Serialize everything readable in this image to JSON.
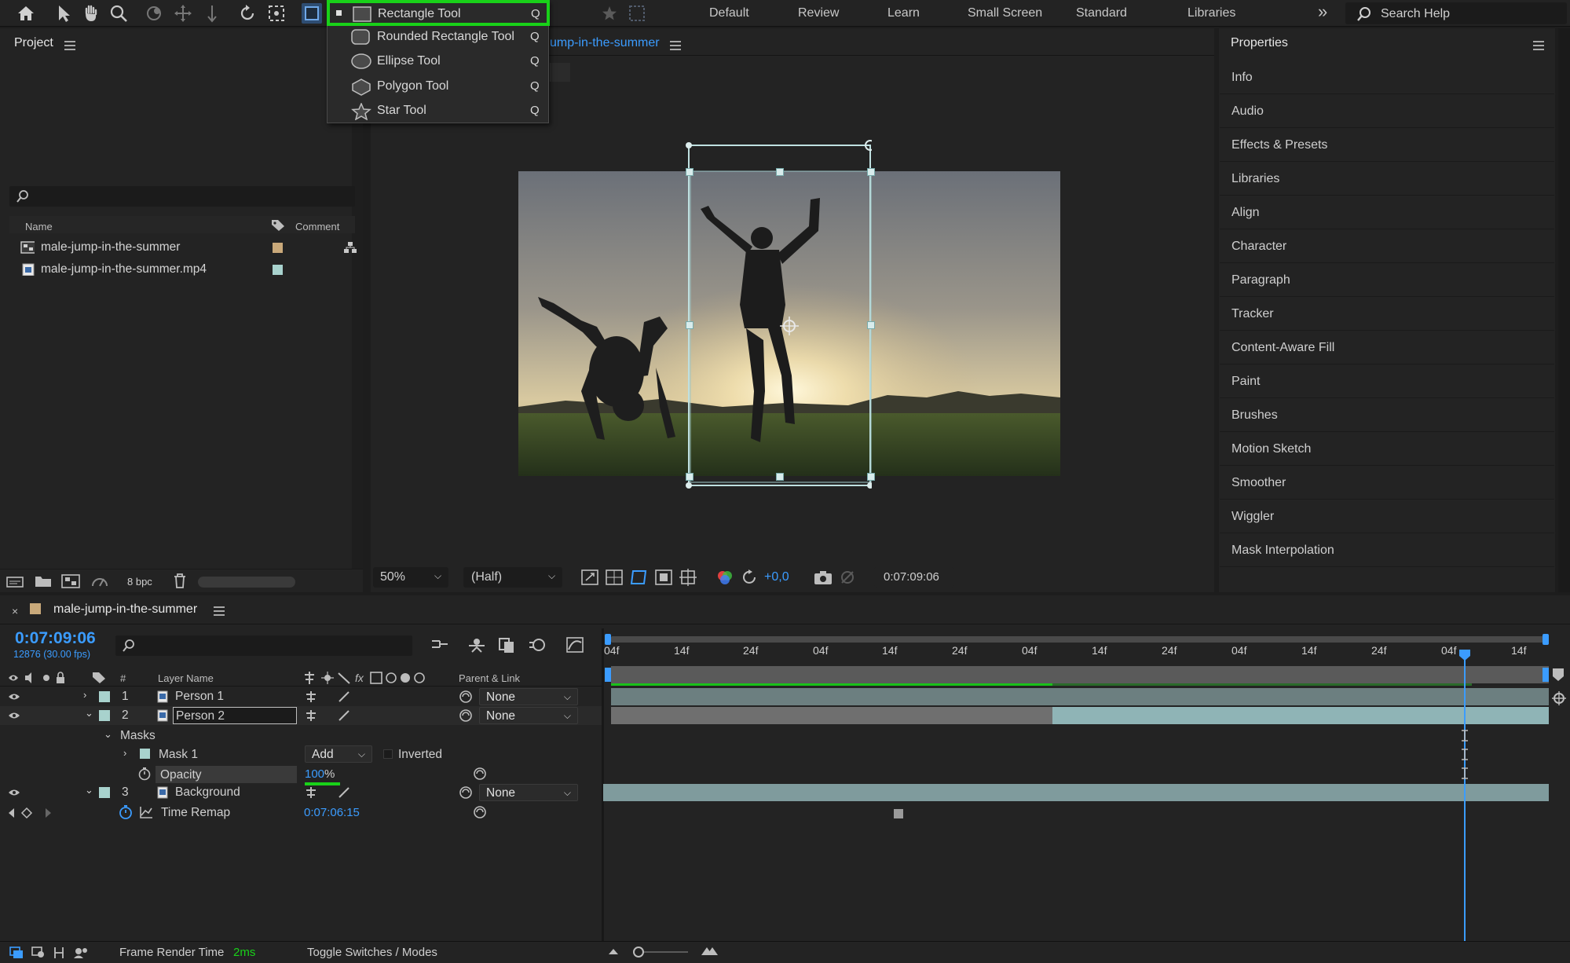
{
  "toolbar": {
    "icons": [
      "home-icon",
      "selection-icon",
      "hand-icon",
      "zoom-icon",
      "orbit-icon",
      "pan-icon",
      "dolly-icon",
      "rotate-icon",
      "pan-behind-icon",
      "shape-tool-icon",
      "star-icon",
      "grid-icon"
    ],
    "workspaces": [
      "Default",
      "Review",
      "Learn",
      "Small Screen",
      "Standard",
      "Libraries"
    ],
    "more_label": "»",
    "search_label": "Search Help"
  },
  "shape_menu": {
    "items": [
      {
        "label": "Rectangle Tool",
        "key": "Q",
        "icon": "rectangle-icon",
        "active": true
      },
      {
        "label": "Rounded Rectangle Tool",
        "key": "Q",
        "icon": "rounded-rectangle-icon"
      },
      {
        "label": "Ellipse Tool",
        "key": "Q",
        "icon": "ellipse-icon"
      },
      {
        "label": "Polygon Tool",
        "key": "Q",
        "icon": "polygon-icon"
      },
      {
        "label": "Star Tool",
        "key": "Q",
        "icon": "star-icon"
      }
    ]
  },
  "project": {
    "title": "Project",
    "columns": {
      "name": "Name",
      "comment": "Comment"
    },
    "items": [
      {
        "name": "male-jump-in-the-summer",
        "type": "composition",
        "label_color": "#c9a97a"
      },
      {
        "name": "male-jump-in-the-summer.mp4",
        "type": "footage",
        "label_color": "#a8d2cd"
      }
    ],
    "bpc": "8 bpc"
  },
  "composition": {
    "tab_label": "ump-in-the-summer",
    "zoom": "50%",
    "resolution": "(Half)",
    "exposure": "+0,0",
    "timecode": "0:07:09:06"
  },
  "properties": {
    "title": "Properties",
    "items": [
      "Info",
      "Audio",
      "Effects & Presets",
      "Libraries",
      "Align",
      "Character",
      "Paragraph",
      "Tracker",
      "Content-Aware Fill",
      "Paint",
      "Brushes",
      "Motion Sketch",
      "Smoother",
      "Wiggler",
      "Mask Interpolation"
    ]
  },
  "timeline": {
    "comp_name": "male-jump-in-the-summer",
    "timecode": "0:07:09:06",
    "frame_info": "12876 (30.00 fps)",
    "headers": {
      "num": "#",
      "layer_name": "Layer Name",
      "parent": "Parent & Link"
    },
    "ruler_labels": [
      "04f",
      "14f",
      "24f",
      "04f",
      "14f",
      "24f",
      "04f",
      "14f",
      "24f",
      "04f",
      "14f",
      "24f",
      "04f",
      "14f"
    ],
    "layers": [
      {
        "num": "1",
        "name": "Person 1",
        "parent": "None"
      },
      {
        "num": "2",
        "name": "Person 2",
        "parent": "None"
      },
      {
        "num": "3",
        "name": "Background",
        "parent": "None"
      }
    ],
    "masks_label": "Masks",
    "mask1_label": "Mask 1",
    "mask_mode": "Add",
    "inverted_label": "Inverted",
    "opacity_label": "Opacity",
    "opacity_value": "100",
    "opacity_unit": "%",
    "time_remap_label": "Time Remap",
    "time_remap_value": "0:07:06:15"
  },
  "status": {
    "frame_render_label": "Frame Render Time",
    "frame_render_value": "2ms",
    "toggle_label": "Toggle Switches / Modes"
  },
  "colors": {
    "accent": "#3b9cff",
    "highlight": "#19d119",
    "teal": "#a8d2cd",
    "clip": "#5f7a7d"
  }
}
